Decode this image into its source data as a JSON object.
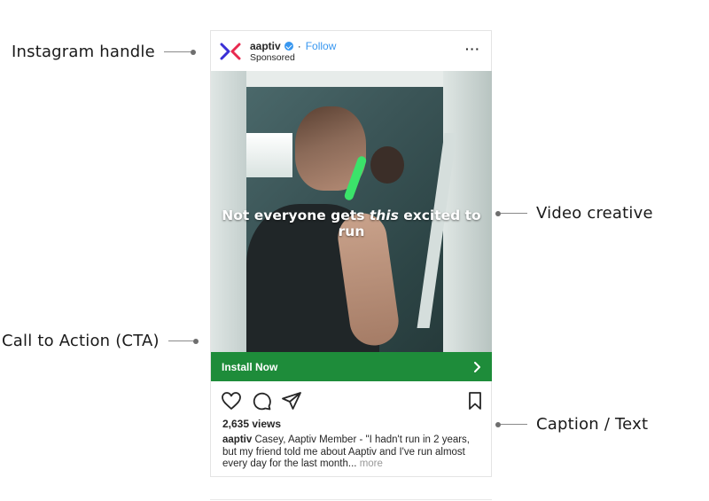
{
  "annotations": {
    "handle": "Instagram handle",
    "video": "Video creative",
    "cta": "Call to Action (CTA)",
    "caption": "Caption / Text"
  },
  "post": {
    "handle": "aaptiv",
    "separator": "·",
    "follow_label": "Follow",
    "sponsored": "Sponsored",
    "more_menu": "···",
    "overlay_before": "Not everyone gets ",
    "overlay_emph": "this",
    "overlay_after": " excited to run",
    "cta_label": "Install Now",
    "cta_chevron": "›",
    "views": "2,635 views",
    "caption_handle": "aaptiv",
    "caption_text": " Casey, Aaptiv Member - \"I hadn't run in 2 years, but my friend told me about Aaptiv and I've run almost every day for the last month...",
    "caption_more": " more"
  },
  "colors": {
    "cta_green": "#1e8c3a",
    "link_blue": "#3897f0",
    "logo_blue": "#3a2fd6",
    "logo_red": "#e8294f"
  },
  "icons": {
    "logo": "aaptiv-logo",
    "verified": "verified-badge-icon",
    "like": "heart-icon",
    "comment": "comment-icon",
    "share": "paper-plane-icon",
    "save": "bookmark-icon",
    "cta": "chevron-right-icon"
  }
}
